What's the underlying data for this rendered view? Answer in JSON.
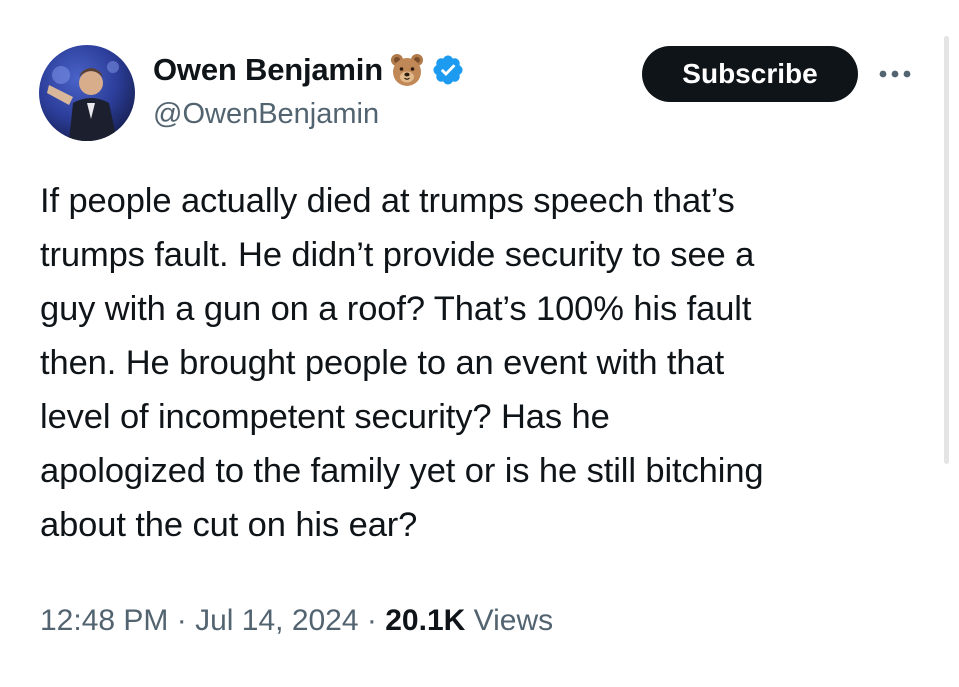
{
  "user": {
    "display_name": "Owen Benjamin",
    "handle": "@OwenBenjamin",
    "badge_emoji": "bear-face-icon",
    "verified": true,
    "verified_color": "#1d9bf0"
  },
  "actions": {
    "subscribe_label": "Subscribe",
    "more_icon": "more-horizontal-icon"
  },
  "tweet": {
    "text": "If people actually died at trumps speech that’s\ntrumps fault. He didn’t provide security to see a\nguy with a gun on a roof? That’s 100% his fault\nthen. He brought people to an event with that\nlevel of incompetent security? Has he\napologized to the family yet or is he still bitching\nabout the cut on his ear?",
    "time": "12:48 PM",
    "separator": " · ",
    "date": "Jul 14, 2024",
    "views_count": "20.1K",
    "views_label": "Views"
  },
  "colors": {
    "text_primary": "#0f1419",
    "text_secondary": "#536471",
    "button_bg": "#0f1419"
  }
}
